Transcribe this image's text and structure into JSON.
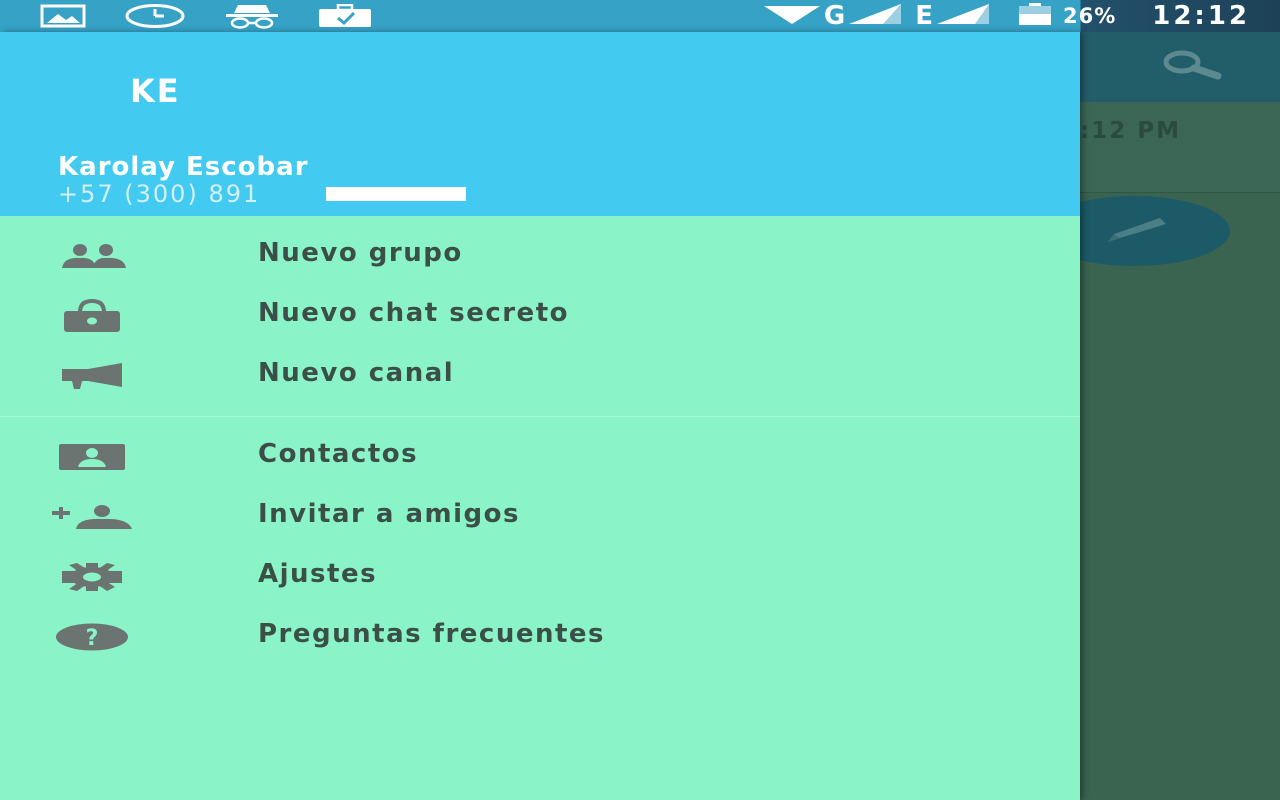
{
  "status_bar": {
    "network_1": "G",
    "network_2": "E",
    "battery_percent": "26%",
    "time": "12:12",
    "icons": [
      "image-icon",
      "sync-icon",
      "incognito-icon",
      "briefcase-icon",
      "wifi-icon",
      "signal-icon",
      "battery-icon"
    ]
  },
  "background_app": {
    "chat_time": ":12 PM",
    "icons": [
      "search-icon",
      "pencil-icon"
    ]
  },
  "drawer": {
    "avatar_initials": "KE",
    "user_name": "Karolay Escobar",
    "user_phone": "+57 (300) 891",
    "menu_primary": [
      {
        "label": "Nuevo grupo",
        "icon": "group-icon"
      },
      {
        "label": "Nuevo chat secreto",
        "icon": "lock-icon"
      },
      {
        "label": "Nuevo canal",
        "icon": "megaphone-icon"
      }
    ],
    "menu_secondary": [
      {
        "label": "Contactos",
        "icon": "contact-card-icon"
      },
      {
        "label": "Invitar a amigos",
        "icon": "add-person-icon"
      },
      {
        "label": "Ajustes",
        "icon": "gear-icon"
      },
      {
        "label": "Preguntas frecuentes",
        "icon": "help-icon"
      }
    ]
  },
  "colors": {
    "header": "#43caf0",
    "drawer_bg": "#8af4c8",
    "text": "#3b4f46",
    "icon": "#6b7470"
  }
}
